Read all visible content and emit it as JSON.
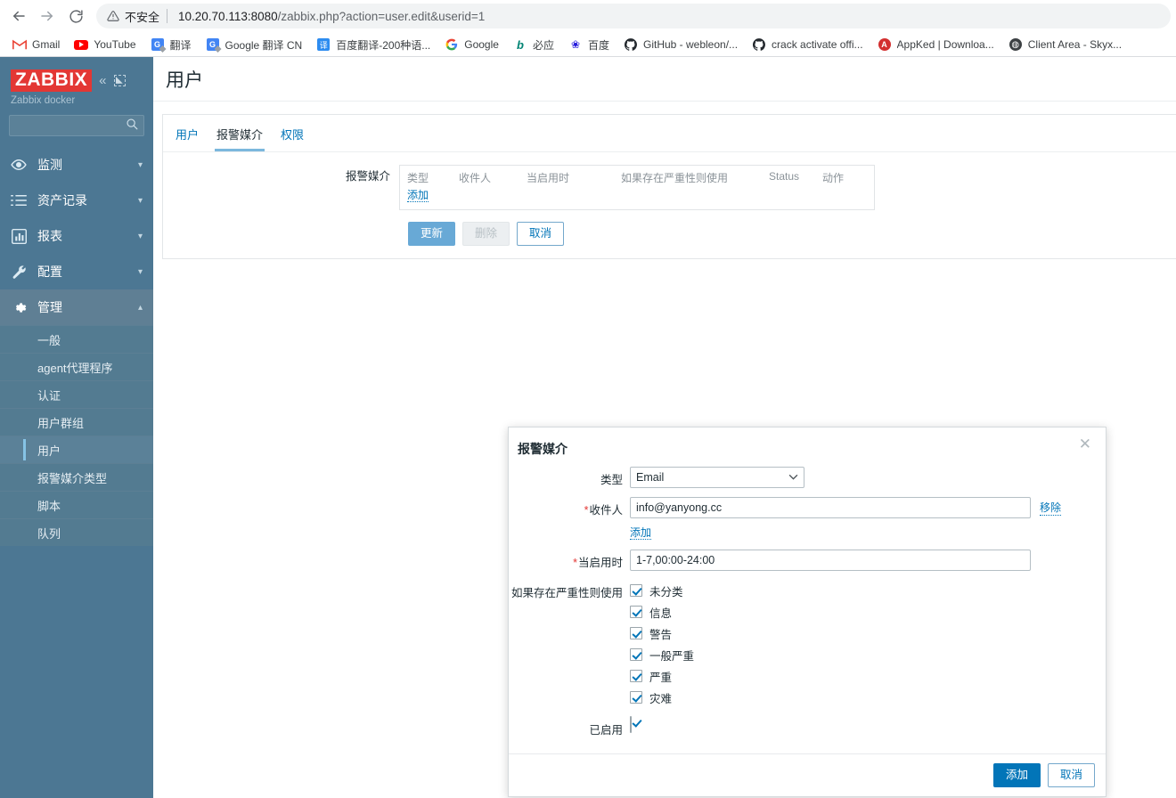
{
  "browser": {
    "back_icon": "arrow-left-icon",
    "forward_icon": "arrow-right-icon",
    "reload_icon": "reload-icon",
    "security_warning_icon": "warning-triangle-icon",
    "security_label": "不安全",
    "url_host": "10.20.70.113:8080",
    "url_path": "/zabbix.php?action=user.edit&userid=1",
    "url_full": "10.20.70.113:8080/zabbix.php?action=user.edit&userid=1",
    "bookmarks": [
      {
        "label": "Gmail",
        "icon": "gmail-icon"
      },
      {
        "label": "YouTube",
        "icon": "youtube-icon"
      },
      {
        "label": "翻译",
        "icon": "google-translate-icon"
      },
      {
        "label": "Google 翻译 CN",
        "icon": "google-translate-icon"
      },
      {
        "label": "百度翻译-200种语...",
        "icon": "baidu-translate-icon"
      },
      {
        "label": "Google",
        "icon": "google-icon"
      },
      {
        "label": "必应",
        "icon": "bing-icon"
      },
      {
        "label": "百度",
        "icon": "baidu-icon"
      },
      {
        "label": "GitHub - webleon/...",
        "icon": "github-icon"
      },
      {
        "label": "crack activate offi...",
        "icon": "github-icon"
      },
      {
        "label": "AppKed | Downloa...",
        "icon": "appked-icon"
      },
      {
        "label": "Client Area - Skyx...",
        "icon": "globe-icon"
      }
    ]
  },
  "sidebar": {
    "logo_text": "ZABBIX",
    "collapse_icon": "chevron-double-left-icon",
    "expand_icon": "expand-corner-icon",
    "server_name": "Zabbix docker",
    "search_placeholder": "",
    "search_value": "",
    "search_icon": "search-icon",
    "nav": [
      {
        "label": "监测",
        "icon": "eye-icon",
        "caret": "chevron-down-icon",
        "active": false
      },
      {
        "label": "资产记录",
        "icon": "list-icon",
        "caret": "chevron-down-icon",
        "active": false
      },
      {
        "label": "报表",
        "icon": "bar-chart-icon",
        "caret": "chevron-down-icon",
        "active": false
      },
      {
        "label": "配置",
        "icon": "wrench-icon",
        "caret": "chevron-down-icon",
        "active": false
      },
      {
        "label": "管理",
        "icon": "gear-icon",
        "caret": "chevron-up-icon",
        "active": true
      }
    ],
    "submenu": [
      {
        "label": "一般",
        "selected": false
      },
      {
        "label": "agent代理程序",
        "selected": false
      },
      {
        "label": "认证",
        "selected": false
      },
      {
        "label": "用户群组",
        "selected": false
      },
      {
        "label": "用户",
        "selected": true
      },
      {
        "label": "报警媒介类型",
        "selected": false
      },
      {
        "label": "脚本",
        "selected": false
      },
      {
        "label": "队列",
        "selected": false
      }
    ]
  },
  "page": {
    "title": "用户",
    "tabs": [
      {
        "label": "用户",
        "active": false
      },
      {
        "label": "报警媒介",
        "active": true
      },
      {
        "label": "权限",
        "active": false
      }
    ],
    "media_row_label": "报警媒介",
    "media_columns": [
      "类型",
      "收件人",
      "当启用时",
      "如果存在严重性则使用",
      "Status",
      "动作"
    ],
    "media_add_link": "添加",
    "buttons": {
      "update": "更新",
      "delete": "删除",
      "cancel": "取消"
    }
  },
  "modal": {
    "title": "报警媒介",
    "close_icon": "close-icon",
    "fields": {
      "type_label": "类型",
      "type_value": "Email",
      "type_chevron": "chevron-down-icon",
      "sendto_label": "收件人",
      "sendto_required": "*",
      "sendto_value": "info@yanyong.cc",
      "remove_link": "移除",
      "add_link": "添加",
      "when_label": "当启用时",
      "when_required": "*",
      "when_value": "1-7,00:00-24:00",
      "severity_label": "如果存在严重性则使用",
      "enabled_label": "已启用",
      "enabled_checked": true
    },
    "severities": [
      {
        "label": "未分类",
        "checked": true
      },
      {
        "label": "信息",
        "checked": true
      },
      {
        "label": "警告",
        "checked": true
      },
      {
        "label": "一般严重",
        "checked": true
      },
      {
        "label": "严重",
        "checked": true
      },
      {
        "label": "灾难",
        "checked": true
      }
    ],
    "buttons": {
      "add": "添加",
      "cancel": "取消"
    }
  },
  "colors": {
    "zabbix_red": "#e33734",
    "sidebar_bg": "#4c7793",
    "link_blue": "#0275b8",
    "primary_button": "#0275b8",
    "light_button": "#68a9d6",
    "required_star": "#e33734",
    "tab_underline": "#7cb8dd"
  }
}
